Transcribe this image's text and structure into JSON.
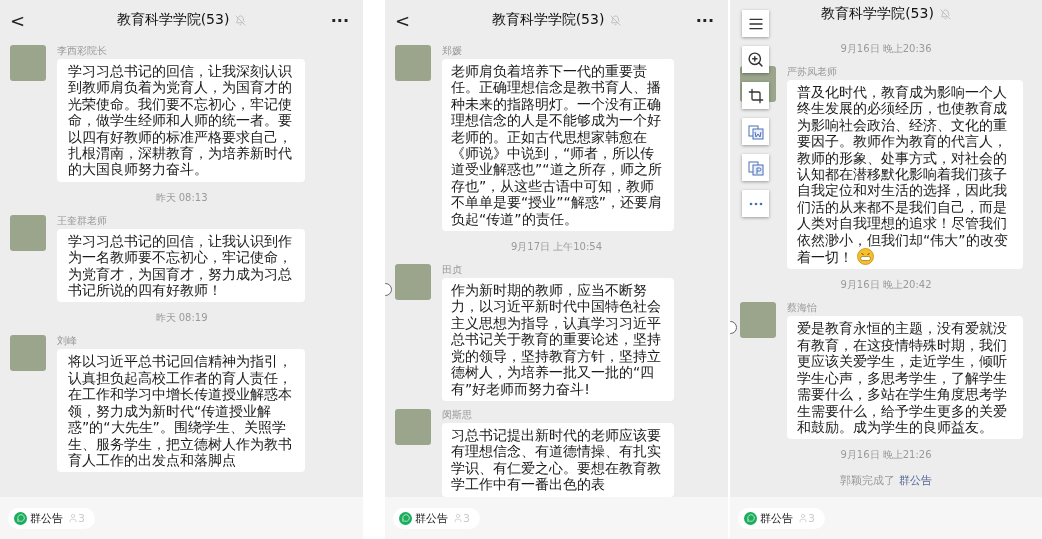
{
  "panels": [
    {
      "header": {
        "back": "<",
        "title": "教育科学学院(53)",
        "more": "···"
      },
      "items": [
        {
          "kind": "message",
          "name": "李西彩院长",
          "text": "学习习总书记的回信，让我深刻认识到教师肩负着为党育人，为国育才的光荣使命。我们要不忘初心，牢记使命，做学生经师和人师的统一者。要以四有好教师的标准严格要求自己，扎根渭南，深耕教育，为培养新时代的大国良师努力奋斗。"
        },
        {
          "kind": "time",
          "text": "昨天 08:13"
        },
        {
          "kind": "message",
          "name": "王奎群老师",
          "text": "学习习总书记的回信，让我认识到作为一名教师要不忘初心，牢记使命，为党育才，为国育才，努力成为习总书记所说的四有好教师！"
        },
        {
          "kind": "time",
          "text": "昨天 08:19"
        },
        {
          "kind": "message",
          "name": "刘峰",
          "text": "将以习近平总书记回信精神为指引，认真担负起高校工作者的育人责任，在工作和学习中增长传道授业解惑本领，努力成为新时代“传道授业解惑”的“大先生”。围绕学生、关照学生、服务学生，把立德树人作为教书育人工作的出发点和落脚点"
        }
      ],
      "footer": {
        "notice": "群公告",
        "count": "3"
      }
    },
    {
      "header": {
        "back": "<",
        "title": "教育科学学院(53)",
        "more": "···"
      },
      "items": [
        {
          "kind": "message",
          "name": "郑媛",
          "text": "老师肩负着培养下一代的重要责任。正确理想信念是教书育人、播种未来的指路明灯。一个没有正确理想信念的人是不能够成为一个好老师的。正如古代思想家韩愈在《师说》中说到，“师者，所以传道受业解惑也”“道之所存，师之所存也”，从这些古语中可知，教师不单单是要“授业”“解惑”，还要肩负起“传道”的责任。"
        },
        {
          "kind": "time",
          "text": "9月17日 上午10:54"
        },
        {
          "kind": "message",
          "name": "田贞",
          "select_circle": true,
          "text": "作为新时期的教师，应当不断努力，以习近平新时代中国特色社会主义思想为指导，认真学习习近平总书记关于教育的重要论述，坚持党的领导，坚持教育方针，坚持立德树人，为培养一批又一批的“四有”好老师而努力奋斗!"
        },
        {
          "kind": "message",
          "name": "闵斯思",
          "text": "习总书记提出新时代的老师应该要有理想信念、有道德情操、有扎实学识、有仁爱之心。要想在教育教学工作中有一番出色的表"
        }
      ],
      "footer": {
        "notice": "群公告",
        "count": "3"
      }
    },
    {
      "header": {
        "title": "教育科学学院(53)"
      },
      "toolbar": [
        {
          "kind": "lines"
        },
        {
          "kind": "zoom"
        },
        {
          "kind": "crop"
        },
        {
          "kind": "word"
        },
        {
          "kind": "slides"
        },
        {
          "kind": "more"
        }
      ],
      "items": [
        {
          "kind": "time",
          "text": "9月16日 晚上20:36"
        },
        {
          "kind": "message",
          "name": "严苏凤老师",
          "emoji": true,
          "text": "普及化时代，教育成为影响一个人终生发展的必须经历，也使教育成为影响社会政治、经济、文化的重要因子。教师作为教育的代言人，教师的形象、处事方式，对社会的认知都在潜移默化影响着我们孩子自我定位和对生活的选择，因此我们活的从来都不是我们自己，而是人类对自我理想的追求！尽管我们依然渺小，但我们却“伟大”的改变着一切！"
        },
        {
          "kind": "time",
          "text": "9月16日 晚上20:42"
        },
        {
          "kind": "message",
          "name": "蔡海怡",
          "select_circle": true,
          "text": "爱是教育永恒的主题，没有爱就没有教育，在这疫情特殊时期，我们更应该关爱学生，走近学生，倾听学生心声，多思考学生，了解学生需要什么，多站在学生角度思考学生需要什么，给予学生更多的关爱和鼓励。成为学生的良师益友。"
        },
        {
          "kind": "time",
          "text": "9月16日 晚上21:26"
        },
        {
          "kind": "system",
          "text": "郭颖完成了",
          "link": "群公告"
        }
      ],
      "footer": {
        "notice": "群公告",
        "count": "3"
      }
    }
  ]
}
